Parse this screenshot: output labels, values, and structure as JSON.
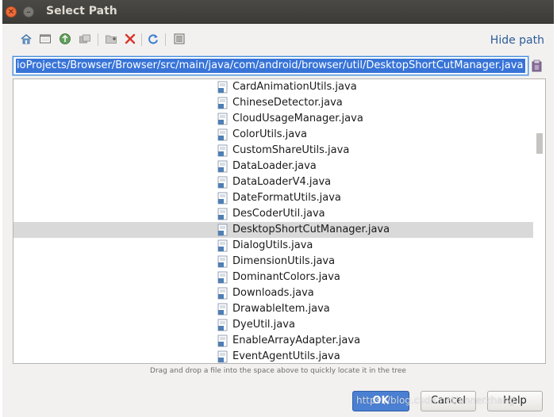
{
  "window": {
    "title": "Select Path"
  },
  "toolbar": {
    "icons": [
      "home-icon",
      "desktop-icon",
      "project-icon",
      "module-icon",
      "new-folder-icon",
      "delete-icon",
      "refresh-icon",
      "show-hidden-icon"
    ],
    "hide_path_label": "Hide path"
  },
  "path": {
    "value": "ioProjects/Browser/Browser/src/main/java/com/android/browser/util/DesktopShortCutManager.java"
  },
  "tree": {
    "items": [
      {
        "label": "CardAnimationUtils.java",
        "selected": false
      },
      {
        "label": "ChineseDetector.java",
        "selected": false
      },
      {
        "label": "CloudUsageManager.java",
        "selected": false
      },
      {
        "label": "ColorUtils.java",
        "selected": false
      },
      {
        "label": "CustomShareUtils.java",
        "selected": false
      },
      {
        "label": "DataLoader.java",
        "selected": false
      },
      {
        "label": "DataLoaderV4.java",
        "selected": false
      },
      {
        "label": "DateFormatUtils.java",
        "selected": false
      },
      {
        "label": "DesCoderUtil.java",
        "selected": false
      },
      {
        "label": "DesktopShortCutManager.java",
        "selected": true
      },
      {
        "label": "DialogUtils.java",
        "selected": false
      },
      {
        "label": "DimensionUtils.java",
        "selected": false
      },
      {
        "label": "DominantColors.java",
        "selected": false
      },
      {
        "label": "Downloads.java",
        "selected": false
      },
      {
        "label": "DrawableItem.java",
        "selected": false
      },
      {
        "label": "DyeUtil.java",
        "selected": false
      },
      {
        "label": "EnableArrayAdapter.java",
        "selected": false
      },
      {
        "label": "EventAgentUtils.java",
        "selected": false
      }
    ]
  },
  "hint": "Drag and drop a file into the space above to quickly locate it in the tree",
  "buttons": {
    "ok": "OK",
    "cancel": "Cancel",
    "help": "Help"
  },
  "watermark": "https://blog.csdn.net/annerzhang",
  "colors": {
    "selection": "#3874d8",
    "ok_button": "#4a7fd2",
    "link": "#2c5b99",
    "titlebar": "#3c3b37"
  }
}
